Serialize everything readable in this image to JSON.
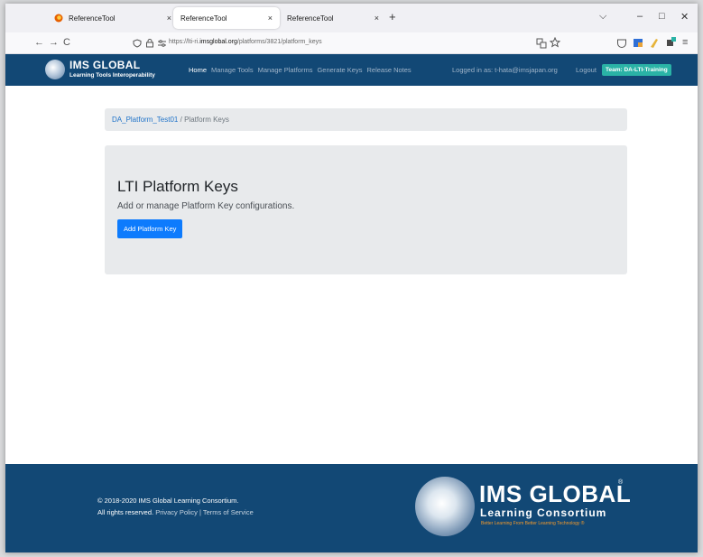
{
  "browser": {
    "tabs": [
      {
        "title": "ReferenceTool",
        "close": "×"
      },
      {
        "title": "ReferenceTool",
        "close": "×"
      },
      {
        "title": "ReferenceTool",
        "close": "×"
      }
    ],
    "new_tab": "+",
    "window_controls": {
      "list": "⌵",
      "minimize": "–",
      "maximize": "□",
      "close": "✕"
    },
    "nav": {
      "back": "←",
      "forward": "→",
      "reload": "C"
    },
    "url_prefix": "https://lti-ri.",
    "url_domain": "imsglobal.org",
    "url_path": "/platforms/3821/platform_keys",
    "accent_color": "#124875"
  },
  "header": {
    "brand_title": "IMS GLOBAL",
    "brand_subtitle": "Learning Tools Interoperability",
    "nav": [
      "Home",
      "Manage Tools",
      "Manage Platforms",
      "Generate Keys",
      "Release Notes"
    ],
    "logged_in": "Logged in as: t-hata@imsjapan.org",
    "logout": "Logout",
    "team": "Team: DA-LTI-Training"
  },
  "breadcrumb": {
    "link": "DA_Platform_Test01",
    "separator": "/",
    "current": "Platform Keys"
  },
  "main": {
    "title": "LTI Platform Keys",
    "lead": "Add or manage Platform Key configurations.",
    "add_button": "Add Platform Key"
  },
  "footer": {
    "copyright": "© 2018-2020 IMS Global Learning Consortium.",
    "rights": "All rights reserved.",
    "privacy": "Privacy Policy",
    "sep": "|",
    "terms": "Terms of Service",
    "logo_title": "IMS GLOBAL",
    "logo_reg": "®",
    "logo_sub": "Learning Consortium",
    "logo_tag": "Better Learning From Better Learning Technology ®"
  }
}
